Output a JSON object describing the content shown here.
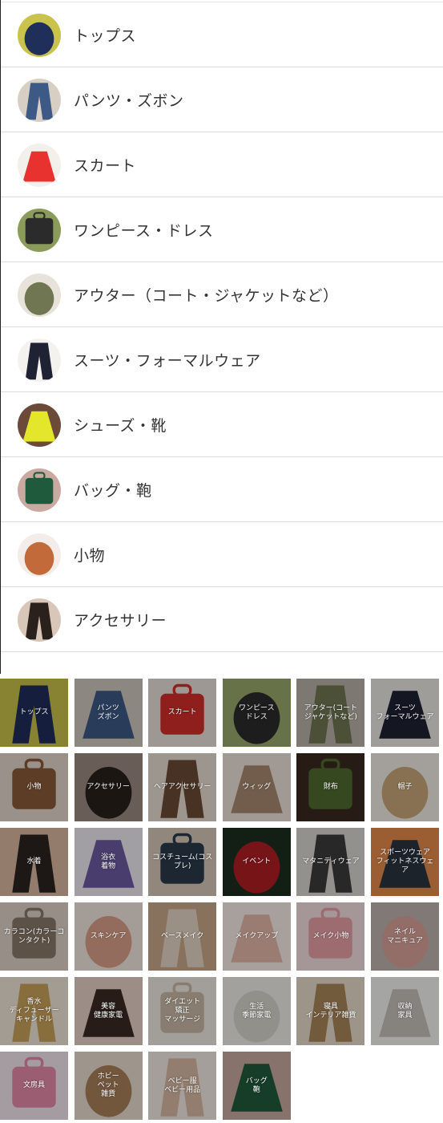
{
  "category_list": [
    {
      "label": "トップス",
      "icon": "tops-thumbnail",
      "colors": [
        "#1f2f5a",
        "#c9c24b"
      ]
    },
    {
      "label": "パンツ・ズボン",
      "icon": "pants-thumbnail",
      "colors": [
        "#3d5a86",
        "#d8cfc4"
      ]
    },
    {
      "label": "スカート",
      "icon": "skirt-thumbnail",
      "colors": [
        "#e8322f",
        "#f3efea"
      ]
    },
    {
      "label": "ワンピース・ドレス",
      "icon": "dress-thumbnail",
      "colors": [
        "#2b2b2b",
        "#8a9b5a"
      ]
    },
    {
      "label": "アウター（コート・ジャケットなど）",
      "icon": "outer-thumbnail",
      "colors": [
        "#6f7651",
        "#e8e3da"
      ]
    },
    {
      "label": "スーツ・フォーマルウェア",
      "icon": "suit-thumbnail",
      "colors": [
        "#1e2233",
        "#f4f2ef"
      ]
    },
    {
      "label": "シューズ・靴",
      "icon": "shoes-thumbnail",
      "colors": [
        "#e3e62a",
        "#6b4a3a"
      ]
    },
    {
      "label": "バッグ・鞄",
      "icon": "bag-thumbnail",
      "colors": [
        "#1f5a3c",
        "#c9a9a0"
      ]
    },
    {
      "label": "小物",
      "icon": "accessories-thumbnail",
      "colors": [
        "#c26a3a",
        "#f4ece8"
      ]
    },
    {
      "label": "アクセサリー",
      "icon": "jewelry-thumbnail",
      "colors": [
        "#2a211d",
        "#d8c6b8"
      ]
    }
  ],
  "tiles": [
    {
      "label": "トップス",
      "icon": "tops-tile",
      "colors": [
        "#1f2f5a",
        "#c9c24b"
      ]
    },
    {
      "label": "パンツ\nズボン",
      "icon": "pants-tile",
      "colors": [
        "#3d5a86",
        "#cfc7bd"
      ]
    },
    {
      "label": "スカート",
      "icon": "skirt-tile",
      "colors": [
        "#d22e2c",
        "#e7e1da"
      ]
    },
    {
      "label": "ワンピース\nドレス",
      "icon": "dress-tile",
      "colors": [
        "#2b2b2b",
        "#9aa86a"
      ]
    },
    {
      "label": "アウター(コート\nジャケットなど)",
      "icon": "outer-tile",
      "colors": [
        "#6f7651",
        "#b9b3a8"
      ]
    },
    {
      "label": "スーツ\nフォーマルウェア",
      "icon": "suit-tile",
      "colors": [
        "#1e2233",
        "#e9e7e3"
      ]
    },
    {
      "label": "小物",
      "icon": "small-goods-tile",
      "colors": [
        "#8b5a3a",
        "#e2d6cc"
      ]
    },
    {
      "label": "アクセサリー",
      "icon": "jewelry-tile",
      "colors": [
        "#2a211d",
        "#9b8a80"
      ]
    },
    {
      "label": "ヘアアクセサリー",
      "icon": "hair-accessory-tile",
      "colors": [
        "#6b4a35",
        "#e8ddd3"
      ]
    },
    {
      "label": "ウィッグ",
      "icon": "wig-tile",
      "colors": [
        "#a88a70",
        "#eee3da"
      ]
    },
    {
      "label": "財布",
      "icon": "wallet-tile",
      "colors": [
        "#4e6a2e",
        "#3a2a1f"
      ]
    },
    {
      "label": "帽子",
      "icon": "hat-tile",
      "colors": [
        "#c8a77a",
        "#f1ece6"
      ]
    },
    {
      "label": "水着",
      "icon": "swimwear-tile",
      "colors": [
        "#2c2320",
        "#d9b79e"
      ]
    },
    {
      "label": "浴衣\n着物",
      "icon": "yukata-tile",
      "colors": [
        "#6b5aa0",
        "#efeaf2"
      ]
    },
    {
      "label": "コスチューム(コス\nプレ)",
      "icon": "costume-tile",
      "colors": [
        "#2a3a4a",
        "#d8c8b8"
      ]
    },
    {
      "label": "イベント",
      "icon": "event-tile",
      "colors": [
        "#b01e24",
        "#1d2f1f"
      ]
    },
    {
      "label": "マタニティウェア",
      "icon": "maternity-tile",
      "colors": [
        "#3b3b3b",
        "#d9d6d2"
      ]
    },
    {
      "label": "スポーツウェア\nフィットネスウェ\nア",
      "icon": "sportswear-tile",
      "colors": [
        "#2a3440",
        "#e58a4a"
      ]
    },
    {
      "label": "カラコン(カラーコ\nンタクト)",
      "icon": "color-contact-tile",
      "colors": [
        "#8a7a6a",
        "#ddd2c8"
      ]
    },
    {
      "label": "スキンケア",
      "icon": "skincare-tile",
      "colors": [
        "#d9a08a",
        "#f2e6df"
      ]
    },
    {
      "label": "ベースメイク",
      "icon": "base-makeup-tile",
      "colors": [
        "#e5d5c4",
        "#c9a98a"
      ]
    },
    {
      "label": "メイクアップ",
      "icon": "makeup-tile",
      "colors": [
        "#e3b7a8",
        "#f6ece7"
      ]
    },
    {
      "label": "メイク小物",
      "icon": "makeup-tools-tile",
      "colors": [
        "#e6a0a6",
        "#f3dde0"
      ]
    },
    {
      "label": "ネイル\nマニキュア",
      "icon": "nail-tile",
      "colors": [
        "#d9a39a",
        "#bfb3ae"
      ]
    },
    {
      "label": "香水\nディフューザー\nキャンドル",
      "icon": "perfume-tile",
      "colors": [
        "#c9a15a",
        "#efe6d8"
      ]
    },
    {
      "label": "美容\n健康家電",
      "icon": "beauty-appliance-tile",
      "colors": [
        "#3a2a22",
        "#e6d2c6"
      ]
    },
    {
      "label": "ダイエット\n矯正\nマッサージ",
      "icon": "diet-tile",
      "colors": [
        "#c9b9a6",
        "#efe9e2"
      ]
    },
    {
      "label": "生活\n季節家電",
      "icon": "home-appliance-tile",
      "colors": [
        "#d8d4cc",
        "#efeee9"
      ]
    },
    {
      "label": "寝具\nインテリア雑貨",
      "icon": "interior-tile",
      "colors": [
        "#a8855a",
        "#e8dccb"
      ]
    },
    {
      "label": "収納\n家具",
      "icon": "storage-tile",
      "colors": [
        "#c6c2bb",
        "#f4f3f0"
      ]
    },
    {
      "label": "文房具",
      "icon": "stationery-tile",
      "colors": [
        "#e58aa8",
        "#f3e6ee"
      ]
    },
    {
      "label": "ホビー\nペット\n雑貨",
      "icon": "hobby-tile",
      "colors": [
        "#a8805a",
        "#e9ddd0"
      ]
    },
    {
      "label": "ベビー服\nベビー用品",
      "icon": "baby-tile",
      "colors": [
        "#d7b9a2",
        "#f2ebe4"
      ]
    },
    {
      "label": "バッグ\n鞄",
      "icon": "bag-tile",
      "colors": [
        "#1f5a3c",
        "#c9a9a0"
      ]
    }
  ]
}
